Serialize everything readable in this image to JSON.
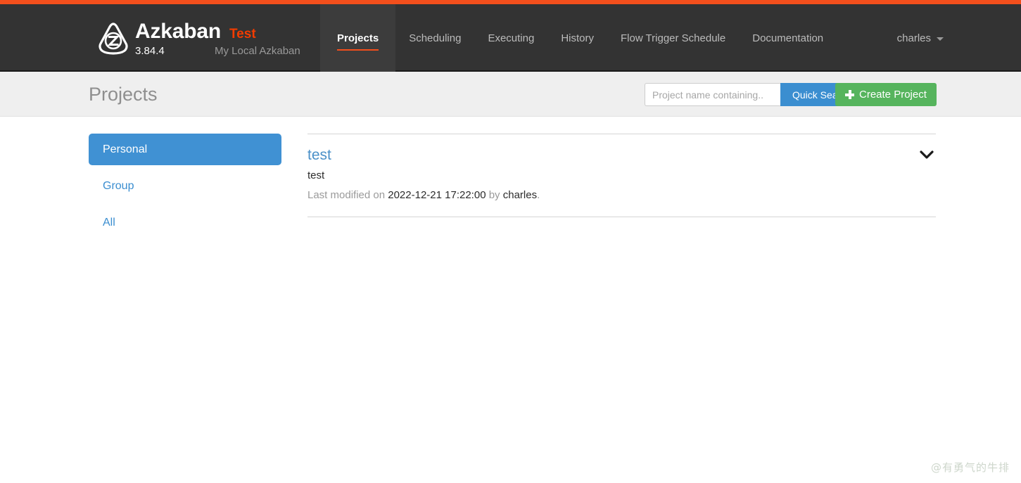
{
  "navbar": {
    "brand_name": "Azkaban",
    "brand_env": "Test",
    "version": "3.84.4",
    "subtitle": "My Local Azkaban",
    "logo_icon": "azkaban-logo-icon",
    "links": [
      {
        "label": "Projects",
        "active": true
      },
      {
        "label": "Scheduling",
        "active": false
      },
      {
        "label": "Executing",
        "active": false
      },
      {
        "label": "History",
        "active": false
      },
      {
        "label": "Flow Trigger Schedule",
        "active": false
      },
      {
        "label": "Documentation",
        "active": false
      }
    ],
    "user": {
      "name": "charles",
      "caret_icon": "caret-down-icon"
    }
  },
  "subheader": {
    "page_title": "Projects",
    "search": {
      "placeholder": "Project name containing..",
      "value": "",
      "button_label": "Quick Search"
    },
    "create_project": {
      "label": "Create Project",
      "icon": "plus-icon"
    }
  },
  "sidebar": {
    "items": [
      {
        "label": "Personal",
        "active": true
      },
      {
        "label": "Group",
        "active": false
      },
      {
        "label": "All",
        "active": false
      }
    ]
  },
  "projects": [
    {
      "name": "test",
      "description": "test",
      "meta_prefix": "Last modified on",
      "modified": "2022-12-21 17:22:00",
      "meta_by": "by",
      "owner": "charles",
      "meta_suffix": ".",
      "expand_icon": "chevron-down-icon"
    }
  ],
  "watermark": "@有勇气的牛排",
  "colors": {
    "accent_orange": "#f34f1c",
    "navbar_dark": "#333333",
    "link_blue": "#3b8ed0",
    "active_blue": "#4091d3",
    "create_green": "#56b45d",
    "env_red": "#f23c00"
  }
}
